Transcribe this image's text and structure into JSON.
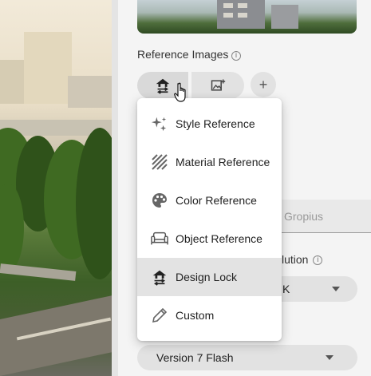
{
  "reference_images": {
    "label": "Reference Images",
    "info_icon": "info-icon",
    "add_symbol": "+"
  },
  "reference_menu": {
    "items": [
      {
        "label": "Style Reference",
        "icon": "sparkles-icon"
      },
      {
        "label": "Material Reference",
        "icon": "hatch-texture-icon"
      },
      {
        "label": "Color Reference",
        "icon": "palette-icon"
      },
      {
        "label": "Object Reference",
        "icon": "sofa-icon"
      },
      {
        "label": "Design Lock",
        "icon": "house-swap-icon",
        "active": true
      },
      {
        "label": "Custom",
        "icon": "pencil-icon"
      }
    ]
  },
  "text_field": {
    "value": "Gropius"
  },
  "resolution": {
    "label": "lution",
    "value": "K"
  },
  "model": {
    "value": "Version 7 Flash"
  },
  "colors": {
    "menu_active": "#e3e3e3",
    "panel_bg": "#f4f4f4",
    "chip_bg": "#e2e2e2"
  }
}
